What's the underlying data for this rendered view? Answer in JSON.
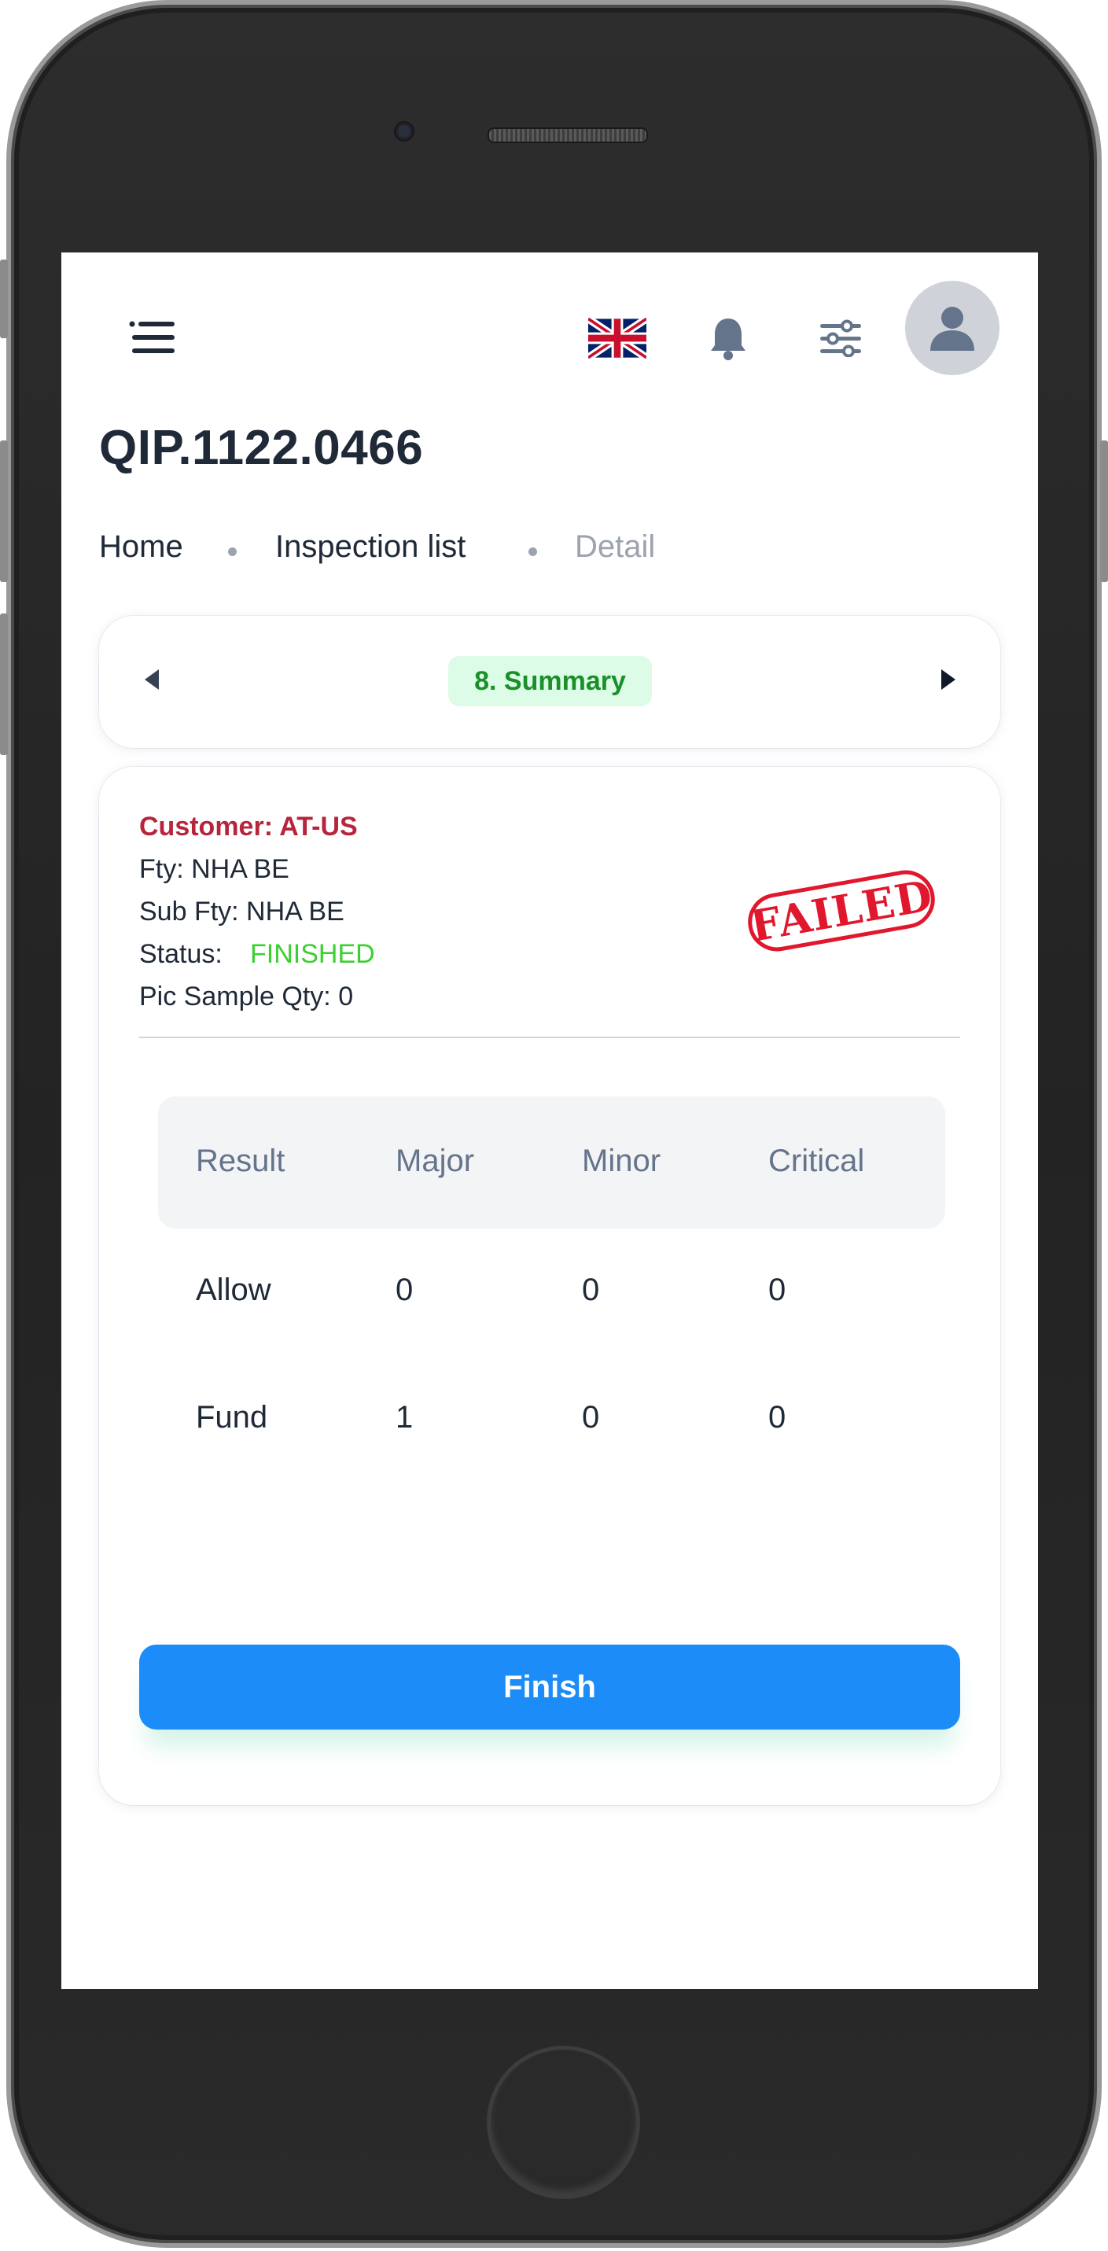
{
  "header": {
    "menu_icon": "menu-icon",
    "language_icon": "uk-flag-icon",
    "notification_icon": "bell-icon",
    "settings_icon": "sliders-icon",
    "avatar_icon": "user-avatar-icon"
  },
  "page": {
    "title": "QIP.1122.0466"
  },
  "breadcrumb": {
    "items": [
      "Home",
      "Inspection list",
      "Detail"
    ]
  },
  "stepper": {
    "current_step": "8. Summary",
    "prev_icon": "caret-left-icon",
    "next_icon": "caret-right-icon"
  },
  "summary": {
    "customer": "Customer: AT-US",
    "factory": "Fty: NHA BE",
    "sub_factory": "Sub Fty: NHA BE",
    "status_label": "Status:",
    "status_value": "FINISHED",
    "pic_sample_qty": "Pic Sample Qty: 0",
    "stamp": "FAILED"
  },
  "table": {
    "columns": [
      "Result",
      "Major",
      "Minor",
      "Critical"
    ],
    "rows": [
      [
        "Allow",
        "0",
        "0",
        "0"
      ],
      [
        "Fund",
        "1",
        "0",
        "0"
      ]
    ]
  },
  "actions": {
    "finish_label": "Finish"
  },
  "colors": {
    "primary": "#1c8cf8",
    "customer_text": "#b7253d",
    "status_finished": "#3ccf32",
    "stamp_red": "#e0172d",
    "step_pill_bg": "#dcfce7",
    "step_pill_text": "#1a8f2a"
  }
}
